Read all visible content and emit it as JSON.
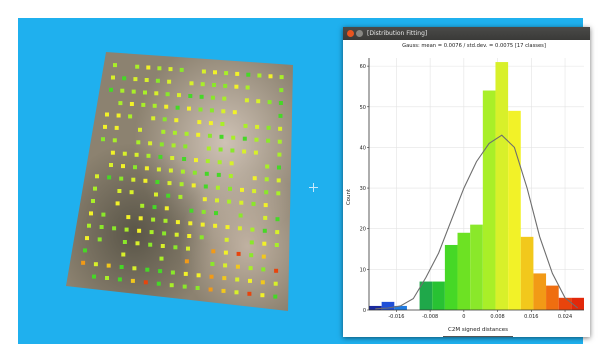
{
  "window": {
    "title": "[Distribution Fitting]"
  },
  "chart_data": {
    "type": "bar",
    "title": "Gauss: mean = 0.0076 / std.dev. = 0.0075 [17 classes]",
    "xlabel": "C2M signed distances",
    "ylabel": "Count",
    "xlim": [
      -0.0225,
      0.0285
    ],
    "ylim": [
      0,
      62
    ],
    "x_ticks": [
      "-0.016",
      "-0.008",
      "0",
      "0.008",
      "0.016",
      "0.024"
    ],
    "x_tick_values": [
      -0.016,
      -0.008,
      0,
      0.008,
      0.016,
      0.024
    ],
    "y_ticks": [
      "0",
      "10",
      "20",
      "30",
      "40",
      "50",
      "60"
    ],
    "y_tick_values": [
      0,
      10,
      20,
      30,
      40,
      50,
      60
    ],
    "bin_edges": [
      -0.0225,
      -0.0195,
      -0.0165,
      -0.0135,
      -0.0105,
      -0.0075,
      -0.0045,
      -0.0015,
      0.0015,
      0.0045,
      0.0075,
      0.0105,
      0.0135,
      0.0165,
      0.0195,
      0.0225,
      0.0255,
      0.0285
    ],
    "values": [
      1,
      2,
      1,
      0,
      7,
      7,
      16,
      19,
      21,
      54,
      61,
      49,
      18,
      9,
      6,
      3,
      3
    ],
    "bar_colors": [
      "#1a2a9e",
      "#1f4fd8",
      "#1f7be0",
      "#20b0c8",
      "#1fa84a",
      "#28c233",
      "#46d826",
      "#6de223",
      "#8ae82a",
      "#a9ef28",
      "#d8f02a",
      "#f2f228",
      "#f2c81c",
      "#f29a16",
      "#ef6e10",
      "#e8440c",
      "#e2280a"
    ],
    "fit_curve": {
      "type": "line",
      "x": [
        -0.021,
        -0.018,
        -0.015,
        -0.012,
        -0.009,
        -0.006,
        -0.003,
        0.0,
        0.003,
        0.006,
        0.009,
        0.012,
        0.015,
        0.018,
        0.021,
        0.024,
        0.027
      ],
      "y": [
        0.3,
        0.5,
        1.0,
        2.8,
        8.0,
        14.0,
        22.0,
        30.0,
        36.5,
        41.0,
        43.0,
        40.0,
        30.0,
        18.0,
        9.0,
        3.0,
        0.5
      ]
    },
    "colors": {
      "curve": "#6e6e6e",
      "axis": "#333333",
      "grid": "#e3e3e3"
    },
    "grid": true
  }
}
